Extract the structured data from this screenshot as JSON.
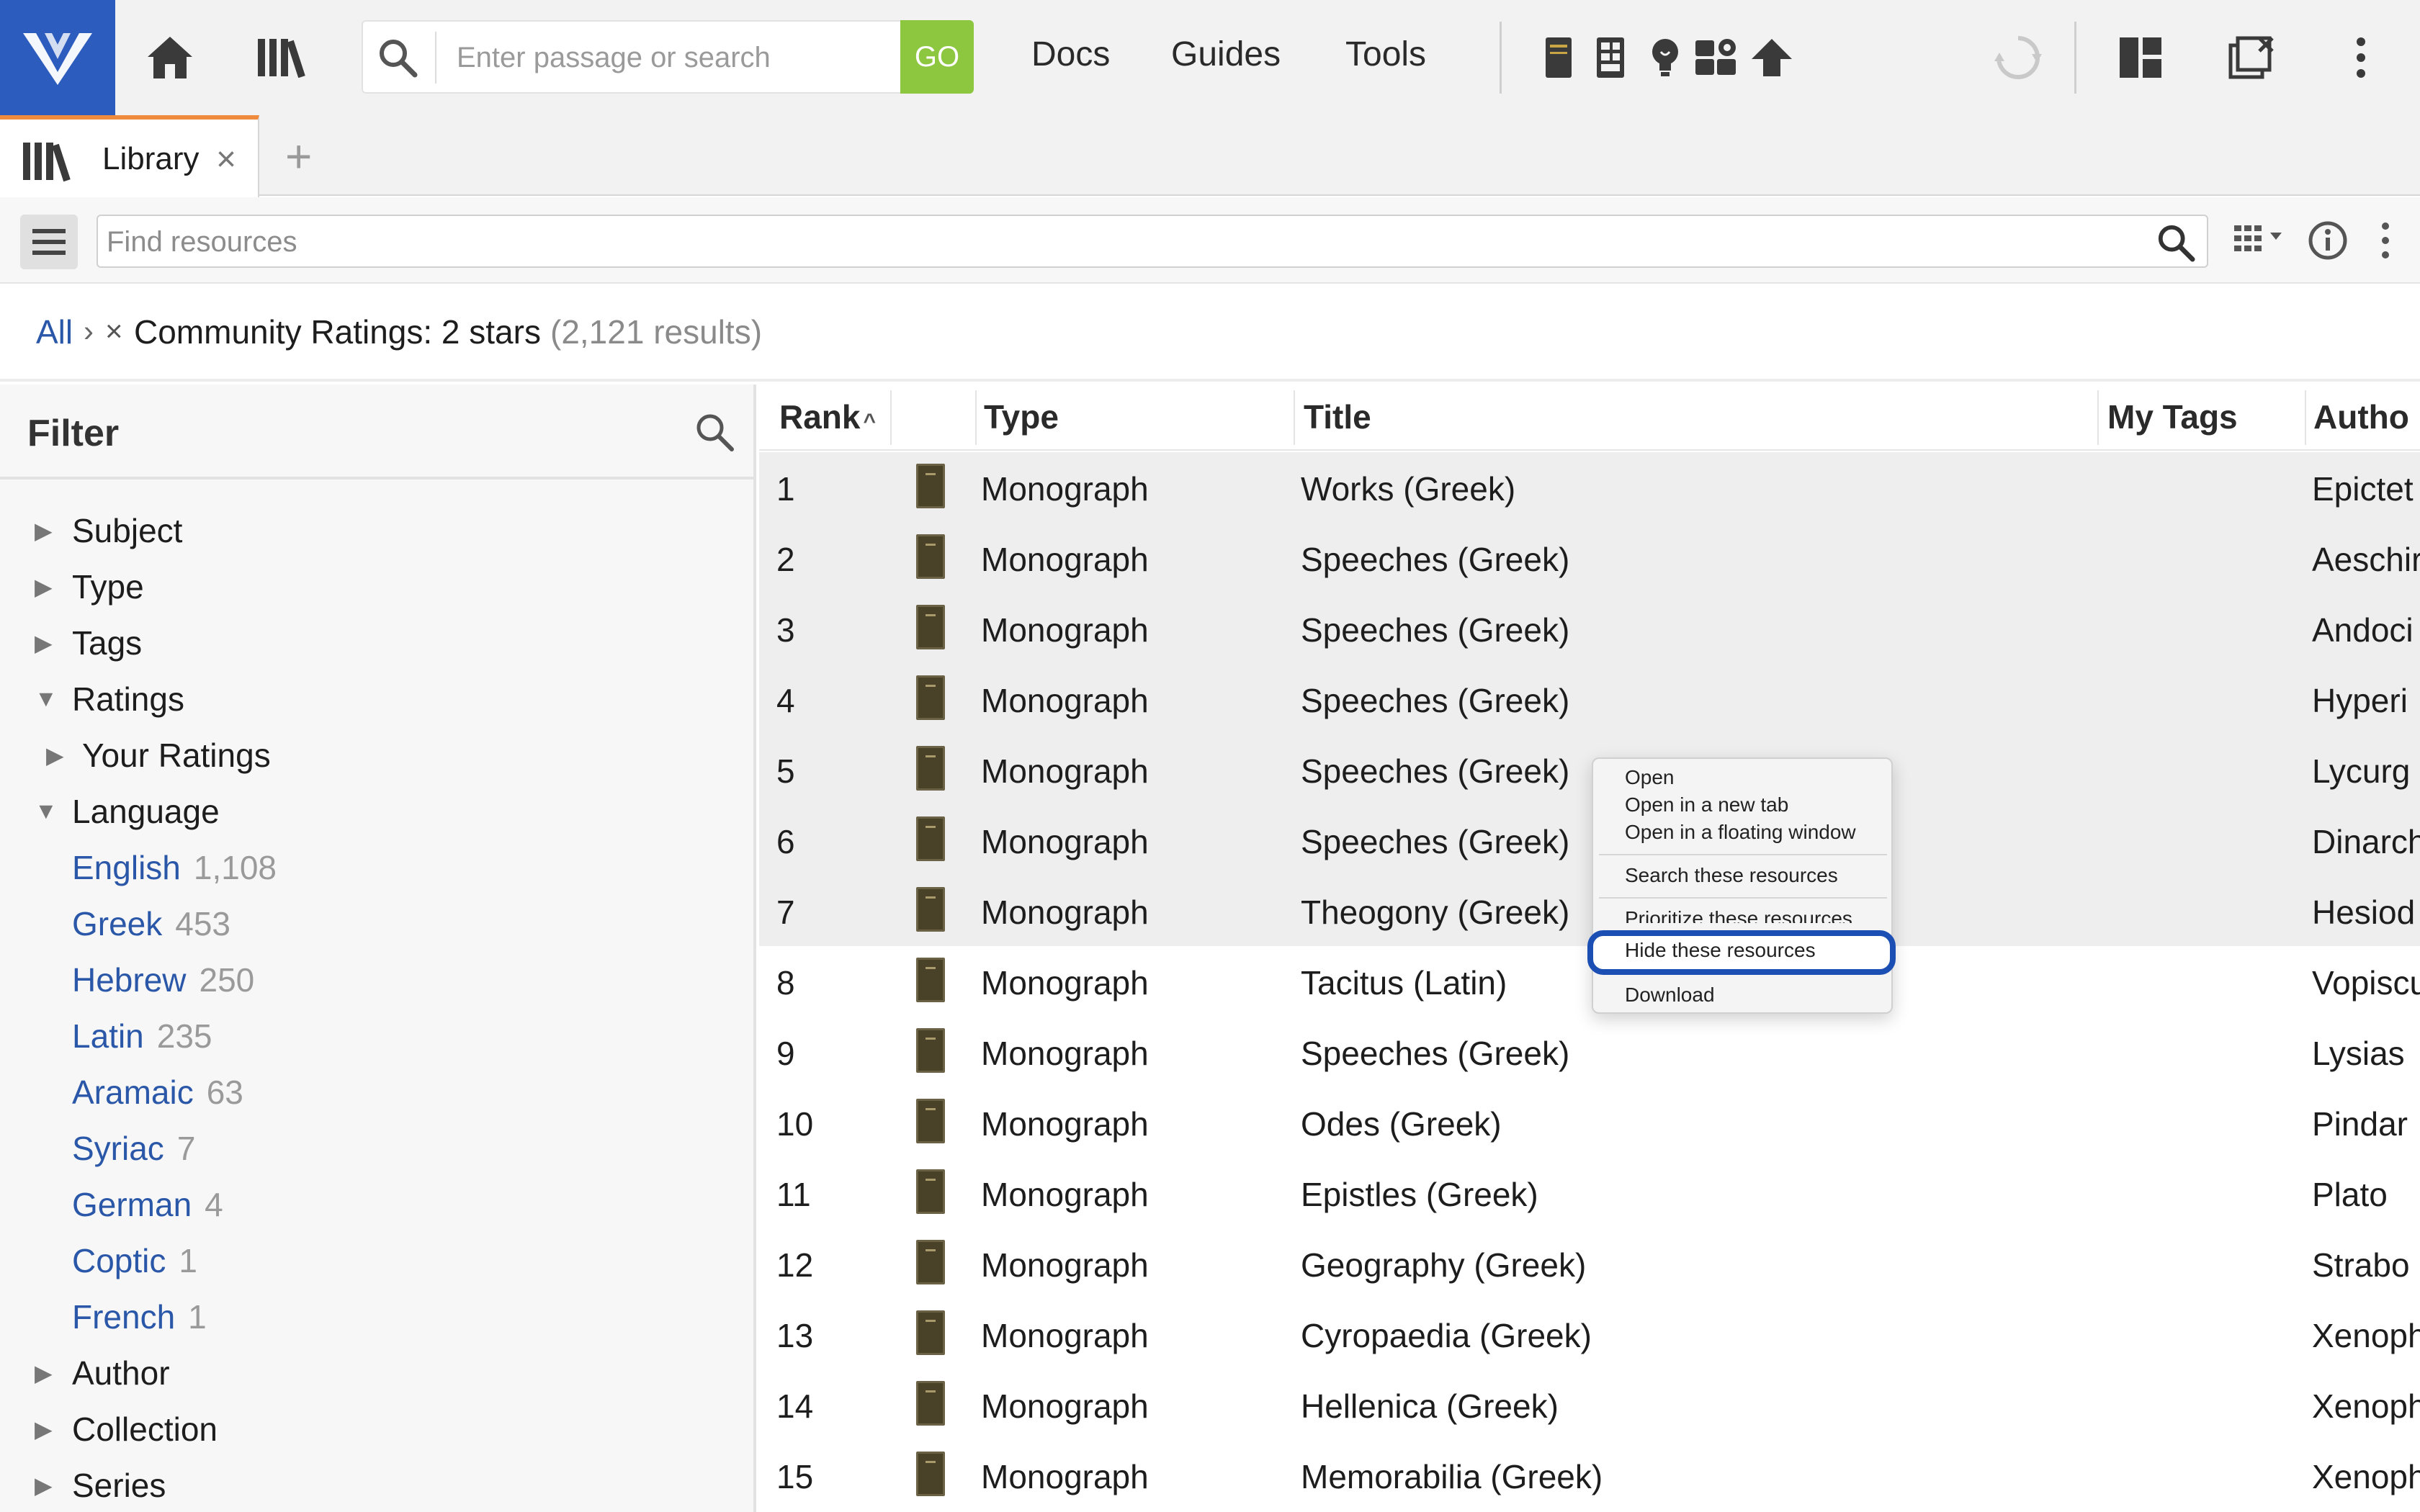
{
  "topbar": {
    "search_placeholder": "Enter passage or search",
    "go_label": "GO",
    "nav": [
      "Docs",
      "Guides",
      "Tools"
    ]
  },
  "tabs": [
    {
      "label": "Library",
      "close": "×"
    }
  ],
  "tab_add": "+",
  "library": {
    "find_placeholder": "Find resources"
  },
  "breadcrumb": {
    "all": "All",
    "sep": "›",
    "remove": "×",
    "filter": "Community Ratings: 2 stars",
    "count": "(2,121 results)"
  },
  "filter": {
    "title": "Filter",
    "facets": {
      "subject": "Subject",
      "type": "Type",
      "tags": "Tags",
      "ratings": "Ratings",
      "your_ratings": "Your Ratings",
      "language": "Language",
      "author": "Author",
      "collection": "Collection",
      "series": "Series"
    },
    "languages": [
      {
        "name": "English",
        "count": "1,108"
      },
      {
        "name": "Greek",
        "count": "453"
      },
      {
        "name": "Hebrew",
        "count": "250"
      },
      {
        "name": "Latin",
        "count": "235"
      },
      {
        "name": "Aramaic",
        "count": "63"
      },
      {
        "name": "Syriac",
        "count": "7"
      },
      {
        "name": "German",
        "count": "4"
      },
      {
        "name": "Coptic",
        "count": "1"
      },
      {
        "name": "French",
        "count": "1"
      }
    ]
  },
  "grid": {
    "columns": {
      "rank": "Rank",
      "type": "Type",
      "title": "Title",
      "tags": "My Tags",
      "author": "Autho"
    },
    "rows": [
      {
        "rank": "1",
        "type": "Monograph",
        "title": "Works (Greek)",
        "author": "Epictet"
      },
      {
        "rank": "2",
        "type": "Monograph",
        "title": "Speeches (Greek)",
        "author": "Aeschir"
      },
      {
        "rank": "3",
        "type": "Monograph",
        "title": "Speeches (Greek)",
        "author": "Andoci"
      },
      {
        "rank": "4",
        "type": "Monograph",
        "title": "Speeches (Greek)",
        "author": "Hyperi"
      },
      {
        "rank": "5",
        "type": "Monograph",
        "title": "Speeches (Greek)",
        "author": "Lycurg"
      },
      {
        "rank": "6",
        "type": "Monograph",
        "title": "Speeches (Greek)",
        "author": "Dinarch"
      },
      {
        "rank": "7",
        "type": "Monograph",
        "title": "Theogony (Greek)",
        "author": "Hesiod"
      },
      {
        "rank": "8",
        "type": "Monograph",
        "title": "Tacitus (Latin)",
        "author": "Vopiscu"
      },
      {
        "rank": "9",
        "type": "Monograph",
        "title": "Speeches (Greek)",
        "author": "Lysias"
      },
      {
        "rank": "10",
        "type": "Monograph",
        "title": "Odes (Greek)",
        "author": "Pindar"
      },
      {
        "rank": "11",
        "type": "Monograph",
        "title": "Epistles (Greek)",
        "author": "Plato"
      },
      {
        "rank": "12",
        "type": "Monograph",
        "title": "Geography (Greek)",
        "author": "Strabo"
      },
      {
        "rank": "13",
        "type": "Monograph",
        "title": "Cyropaedia (Greek)",
        "author": "Xenoph"
      },
      {
        "rank": "14",
        "type": "Monograph",
        "title": "Hellenica (Greek)",
        "author": "Xenoph"
      },
      {
        "rank": "15",
        "type": "Monograph",
        "title": "Memorabilia (Greek)",
        "author": "Xenoph"
      }
    ]
  },
  "context_menu": {
    "open": "Open",
    "open_new_tab": "Open in a new tab",
    "open_floating": "Open in a floating window",
    "search_these": "Search these resources",
    "prioritize": "Prioritize these resources",
    "hide": "Hide these resources",
    "download": "Download"
  },
  "colors": {
    "brand": "#2c5cbe",
    "go": "#8dc63f",
    "tab_accent": "#f08a3c",
    "link": "#2a57a8",
    "highlight": "#1c4fb3"
  }
}
